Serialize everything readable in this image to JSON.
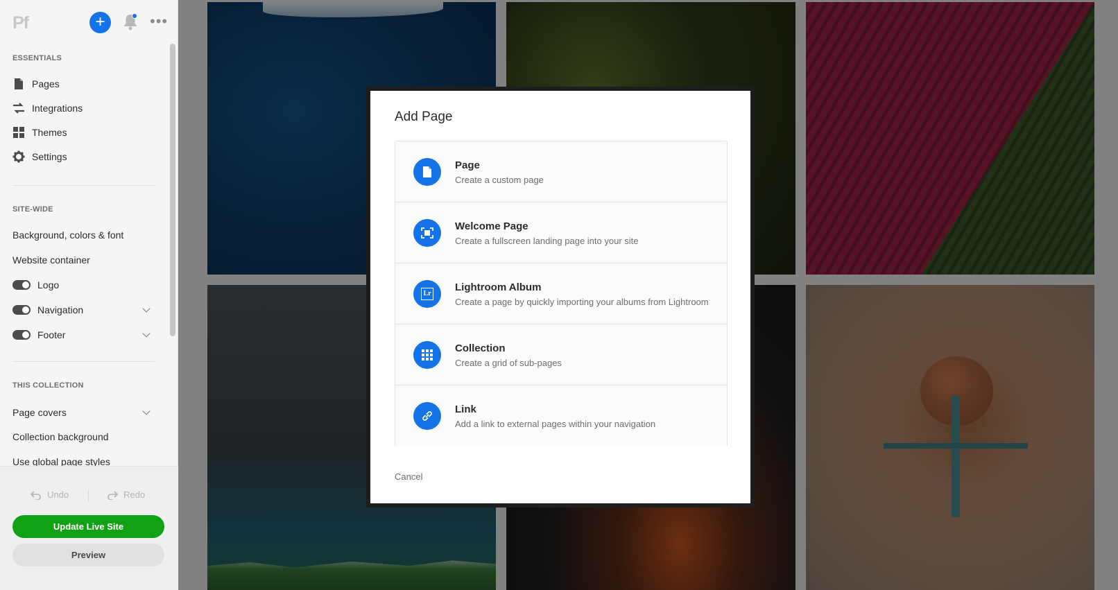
{
  "app": {
    "logo_text": "Pf",
    "add_symbol": "+",
    "more_symbol": "•••",
    "accent_color": "#1473e6"
  },
  "sidebar": {
    "essentials": {
      "heading": "ESSENTIALS",
      "items": [
        {
          "label": "Pages",
          "icon": "page-icon"
        },
        {
          "label": "Integrations",
          "icon": "integrations-icon"
        },
        {
          "label": "Themes",
          "icon": "themes-icon"
        },
        {
          "label": "Settings",
          "icon": "gear-icon"
        }
      ]
    },
    "site_wide": {
      "heading": "SITE-WIDE",
      "items": [
        {
          "label": "Background, colors & font"
        },
        {
          "label": "Website container"
        }
      ],
      "toggles": [
        {
          "label": "Logo",
          "on": true,
          "expandable": false
        },
        {
          "label": "Navigation",
          "on": true,
          "expandable": true
        },
        {
          "label": "Footer",
          "on": true,
          "expandable": true
        }
      ]
    },
    "this_collection": {
      "heading": "THIS COLLECTION",
      "items": [
        {
          "label": "Page covers",
          "expandable": true
        },
        {
          "label": "Collection background"
        },
        {
          "label": "Use global page styles"
        }
      ]
    },
    "footer": {
      "undo_label": "Undo",
      "redo_label": "Redo",
      "update_label": "Update Live Site",
      "preview_label": "Preview",
      "update_color": "#12a114"
    }
  },
  "modal": {
    "title": "Add Page",
    "options": [
      {
        "title": "Page",
        "description": "Create a custom page",
        "icon": "page-icon"
      },
      {
        "title": "Welcome Page",
        "description": "Create a fullscreen landing page into your site",
        "icon": "fullscreen-icon"
      },
      {
        "title": "Lightroom Album",
        "description": "Create a page by quickly importing your albums from Lightroom",
        "icon": "lightroom-icon",
        "icon_text": "Lr"
      },
      {
        "title": "Collection",
        "description": "Create a grid of sub-pages",
        "icon": "grid-icon"
      },
      {
        "title": "Link",
        "description": "Add a link to external pages within your navigation",
        "icon": "link-icon"
      }
    ],
    "cancel_label": "Cancel"
  }
}
